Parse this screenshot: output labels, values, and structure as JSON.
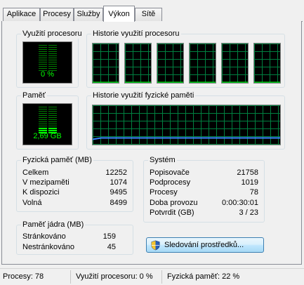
{
  "tabs": [
    "Aplikace",
    "Procesy",
    "Služby",
    "Výkon",
    "Sítě"
  ],
  "active_tab": "Výkon",
  "cpu_usage": {
    "title": "Využití procesoru",
    "value": "0 %",
    "level": 0
  },
  "cpu_history": {
    "title": "Historie využití procesoru",
    "cores": 6
  },
  "memory": {
    "title": "Paměť",
    "value": "2,69 GB",
    "level": 0.22
  },
  "memory_history": {
    "title": "Historie využití fyzické paměti",
    "level": 0.22
  },
  "physical_memory": {
    "title": "Fyzická paměť (MB)",
    "rows": [
      {
        "label": "Celkem",
        "value": "12252"
      },
      {
        "label": "V mezipaměti",
        "value": "1074"
      },
      {
        "label": "K dispozici",
        "value": "9495"
      },
      {
        "label": "Volná",
        "value": "8499"
      }
    ]
  },
  "system": {
    "title": "Systém",
    "rows": [
      {
        "label": "Popisovače",
        "value": "21758"
      },
      {
        "label": "Podprocesy",
        "value": "1019"
      },
      {
        "label": "Procesy",
        "value": "78"
      },
      {
        "label": "Doba provozu",
        "value": "0:00:30:01"
      },
      {
        "label": "Potvrdit (GB)",
        "value": "3 / 23"
      }
    ]
  },
  "kernel_memory": {
    "title": "Paměť jádra (MB)",
    "rows": [
      {
        "label": "Stránkováno",
        "value": "159"
      },
      {
        "label": "Nestránkováno",
        "value": "45"
      }
    ]
  },
  "resource_monitor_button": "Sledování prostředků...",
  "statusbar": {
    "processes": "Procesy: 78",
    "cpu": "Využití procesoru: 0 %",
    "memory": "Fyzická paměť: 22 %"
  },
  "colors": {
    "graph_grid": "#008040",
    "graph_line": "#00ff00",
    "memory_line": "#3a86ff"
  }
}
